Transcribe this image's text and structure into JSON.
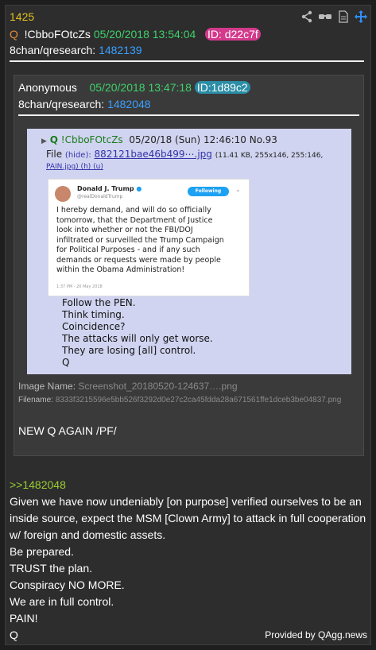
{
  "post": {
    "number": "1425",
    "trip_prefix": "Q",
    "tripcode": "!CbboFOtcZs",
    "datetime": "05/20/2018 13:54:04",
    "id": "ID: d22c7f",
    "board": "8chan/qresearch:",
    "thread": "1482139"
  },
  "quoted": {
    "author": "Anonymous",
    "datetime": "05/20/2018 13:47:18",
    "id": "ID:1d89c2",
    "board": "8chan/qresearch:",
    "thread": "1482048",
    "image": {
      "line1_arrow": "▶",
      "line1_q": "Q",
      "line1_trip": "!CbboFOtcZs",
      "line1_date": "05/20/18 (Sun) 12:46:10 No.93",
      "line2_file": "File",
      "line2_hide": "(hide):",
      "line2_name": "882121bae46b499⋯.jpg",
      "line2_info": "(11.41 KB, 255x146, 255:146,",
      "line3": "PAIN.jpg) (h) (u)",
      "tweet_name": "Donald J. Trump",
      "tweet_handle": "@realDonaldTrump",
      "tweet_follow": "Following",
      "tweet_lines": [
        "I hereby demand, and will do so officially",
        "tomorrow, that the Department of Justice",
        "look into whether or not the FBI/DOJ",
        "infiltrated or surveilled the Trump Campaign",
        "for Political Purposes - and if any such",
        "demands or requests were made by people",
        "within the Obama Administration!"
      ],
      "tweet_time": "1:37 PM - 20 May 2018",
      "caption_lines": [
        "Follow the PEN.",
        "Think timing.",
        "Coincidence?",
        "The attacks will only get worse.",
        "They are losing [all] control.",
        "Q"
      ]
    },
    "image_name_label": "Image Name:",
    "image_name": "Screenshot_20180520-124637….png",
    "filename_label": "Filename:",
    "filename": "8333f3215596e5bb526f3292d0e27c2ca45fdda28a671561ffe1dceb3be04837.png",
    "text": "NEW Q AGAIN /PF/"
  },
  "body": {
    "reply_link": ">>1482048",
    "lines": [
      "Given we have now undeniably [on purpose] verified ourselves to be an",
      "inside source, expect the MSM [Clown Army] to attack in full cooperation",
      "w/ foreign and domestic assets.",
      "Be prepared.",
      "TRUST the plan.",
      "Conspiracy NO MORE.",
      "We are in full control.",
      "PAIN!",
      "Q"
    ]
  },
  "footer": "Provided by QAgg.news",
  "icons": [
    "share-icon",
    "glasses-icon",
    "document-icon",
    "move-icon"
  ],
  "colors": {
    "number": "#e0c020",
    "trip_q": "#e58a3a",
    "date": "#3fd06a",
    "link": "#3aa0ff",
    "id_badge_post": "#d33a8c",
    "id_badge_quote": "#2b8da6",
    "reply_link": "#9acd32"
  }
}
